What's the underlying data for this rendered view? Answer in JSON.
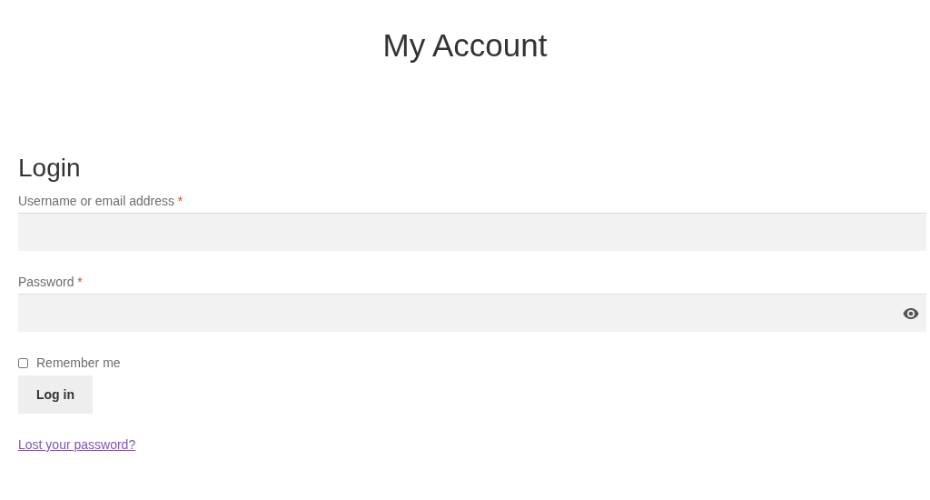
{
  "page_title": "My Account",
  "login": {
    "heading": "Login",
    "fields": [
      {
        "kind": "text",
        "label": "Username or email address",
        "required_mark": "*"
      },
      {
        "kind": "password",
        "label": "Password",
        "required_mark": "*"
      }
    ],
    "remember": {
      "label": "Remember me",
      "checked": false
    },
    "button": "Log in",
    "lost_password_link": "Lost your password?"
  }
}
